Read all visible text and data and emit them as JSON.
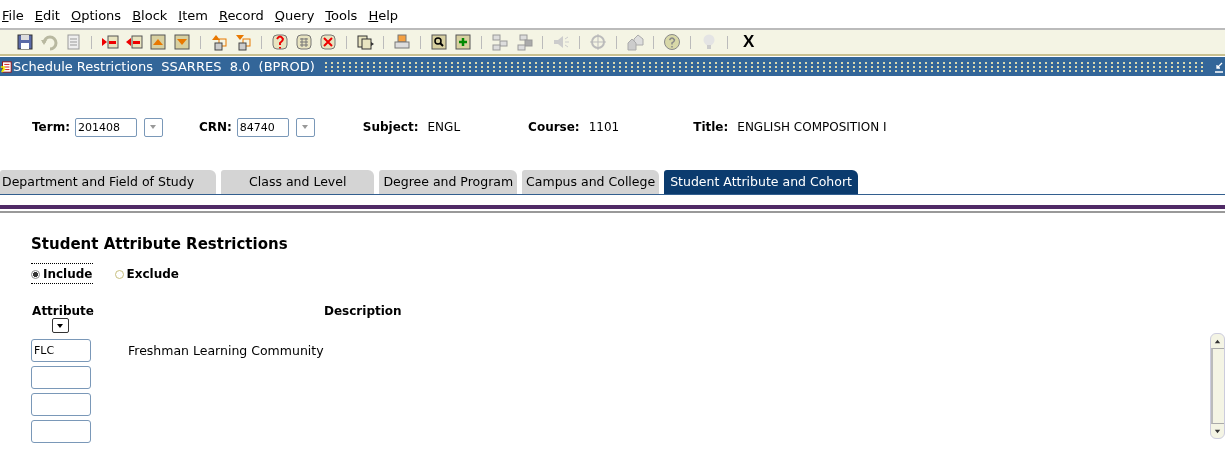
{
  "menu": [
    {
      "label": "File"
    },
    {
      "label": "Edit"
    },
    {
      "label": "Options"
    },
    {
      "label": "Block"
    },
    {
      "label": "Item"
    },
    {
      "label": "Record"
    },
    {
      "label": "Query"
    },
    {
      "label": "Tools"
    },
    {
      "label": "Help"
    }
  ],
  "toolbar": {
    "exit_label": "X"
  },
  "window": {
    "title": "Schedule Restrictions  SSARRES  8.0  (BPROD)"
  },
  "key_block": {
    "term": {
      "label": "Term:",
      "value": "201408"
    },
    "crn": {
      "label": "CRN:",
      "value": "84740"
    },
    "subject": {
      "label": "Subject:",
      "value": "ENGL"
    },
    "course": {
      "label": "Course:",
      "value": "1101"
    },
    "title": {
      "label": "Title:",
      "value": "ENGLISH COMPOSITION I"
    }
  },
  "tabs": [
    {
      "label": "Department and Field of Study",
      "selected": false
    },
    {
      "label": "Class and Level",
      "selected": false
    },
    {
      "label": "Degree and Program",
      "selected": false
    },
    {
      "label": "Campus and College",
      "selected": false
    },
    {
      "label": "Student Attribute and Cohort",
      "selected": true
    }
  ],
  "section": {
    "heading": "Student Attribute Restrictions",
    "options": [
      {
        "label": "Include",
        "selected": true
      },
      {
        "label": "Exclude",
        "selected": false
      }
    ],
    "columns": [
      "Attribute",
      "Description"
    ],
    "rows": [
      {
        "attribute": "FLC",
        "description": "Freshman Learning Community"
      },
      {},
      {},
      {}
    ]
  }
}
